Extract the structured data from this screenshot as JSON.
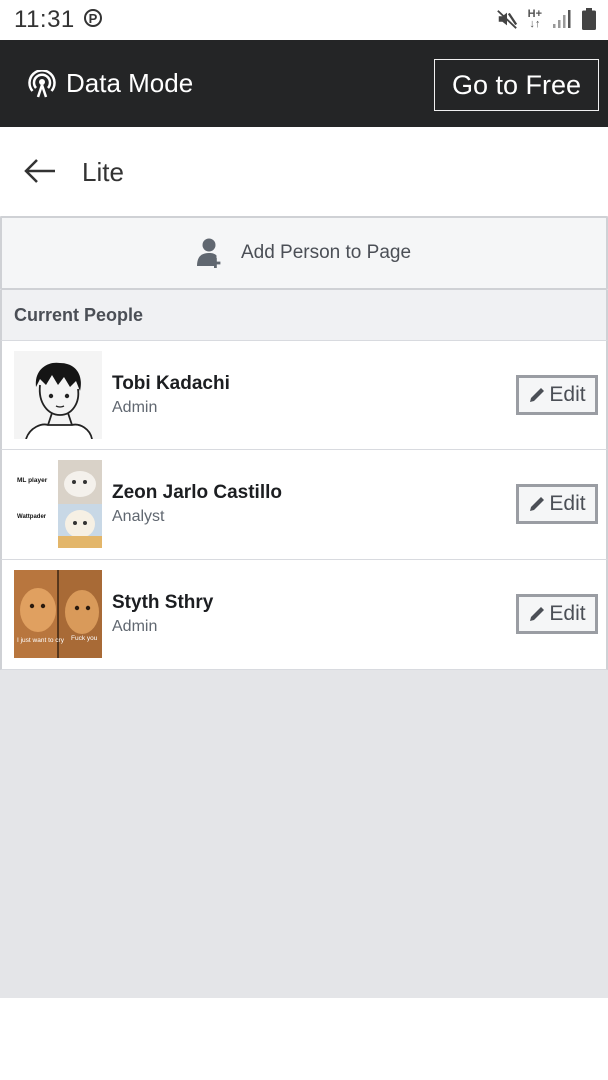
{
  "status_bar": {
    "time": "11:31",
    "app_icon_letter": "P",
    "network_label_top": "H+",
    "network_label_bottom": "↓↑"
  },
  "data_bar": {
    "icon": "antenna-icon",
    "label": "Data Mode",
    "go_free_label": "Go to Free"
  },
  "header": {
    "back_icon": "arrow-left-icon",
    "title": "Lite"
  },
  "add_person": {
    "icon": "add-person-icon",
    "label": "Add Person to Page"
  },
  "current_people": {
    "header": "Current People",
    "people": [
      {
        "name": "Tobi Kadachi",
        "role": "Admin",
        "edit_label": "Edit"
      },
      {
        "name": "Zeon Jarlo Castillo",
        "role": "Analyst",
        "edit_label": "Edit",
        "avatar_text_1": "ML player",
        "avatar_text_2": "Wattpader"
      },
      {
        "name": "Styth Sthry",
        "role": "Admin",
        "edit_label": "Edit",
        "avatar_text_1": "I just want to cry",
        "avatar_text_2": "Fuck you"
      }
    ]
  },
  "colors": {
    "data_bar_bg": "#242526",
    "content_bg": "#e4e5e8",
    "button_border": "#9a9da3"
  }
}
